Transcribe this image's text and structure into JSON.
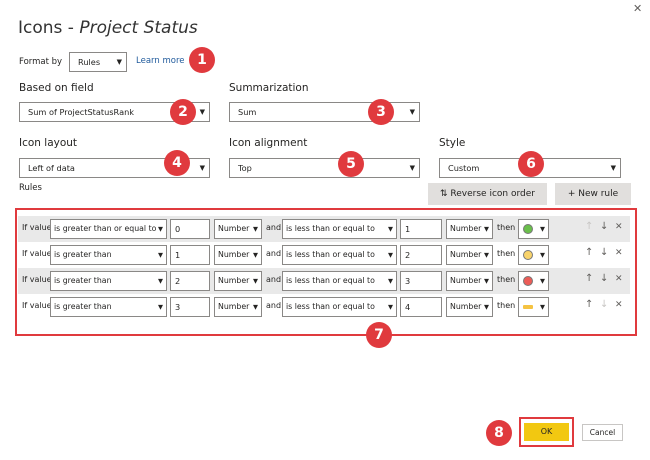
{
  "dialog": {
    "title_main": "Icons - ",
    "title_field": "Project Status",
    "close_glyph": "✕"
  },
  "format_by": {
    "label": "Format by",
    "value": "Rules",
    "learn_more": "Learn more"
  },
  "based_on_field": {
    "label": "Based on field",
    "value": "Sum of ProjectStatusRank"
  },
  "summarization": {
    "label": "Summarization",
    "value": "Sum"
  },
  "icon_layout": {
    "label": "Icon layout",
    "value": "Left of data"
  },
  "icon_alignment": {
    "label": "Icon alignment",
    "value": "Top"
  },
  "style": {
    "label": "Style",
    "value": "Custom"
  },
  "rules": {
    "label": "Rules",
    "reverse_button": "Reverse icon order",
    "reverse_glyph": "⇅",
    "new_rule_button": "New rule",
    "new_rule_glyph": "+",
    "if_value": "If value",
    "and": "and",
    "then": "then",
    "up_glyph": "↑",
    "down_glyph": "↓",
    "delete_glyph": "✕",
    "rows": [
      {
        "op1": "is greater than or equal to",
        "v1": "0",
        "t1": "Number",
        "op2": "is less than or equal to",
        "v2": "1",
        "t2": "Number",
        "icon": "green-circle",
        "color": "#6abf4b"
      },
      {
        "op1": "is greater than",
        "v1": "1",
        "t1": "Number",
        "op2": "is less than or equal to",
        "v2": "2",
        "t2": "Number",
        "icon": "yellow-circle",
        "color": "#f8d36b"
      },
      {
        "op1": "is greater than",
        "v1": "2",
        "t1": "Number",
        "op2": "is less than or equal to",
        "v2": "3",
        "t2": "Number",
        "icon": "red-circle",
        "color": "#ec5c57"
      },
      {
        "op1": "is greater than",
        "v1": "3",
        "t1": "Number",
        "op2": "is less than or equal to",
        "v2": "4",
        "t2": "Number",
        "icon": "yellow-dash",
        "color": "#f5c342"
      }
    ]
  },
  "badges": [
    "1",
    "2",
    "3",
    "4",
    "5",
    "6",
    "7",
    "8"
  ],
  "footer": {
    "ok": "OK",
    "cancel": "Cancel"
  },
  "colors": {
    "highlight": "#e03a3e",
    "ok": "#f2c811",
    "link": "#215b9c"
  }
}
